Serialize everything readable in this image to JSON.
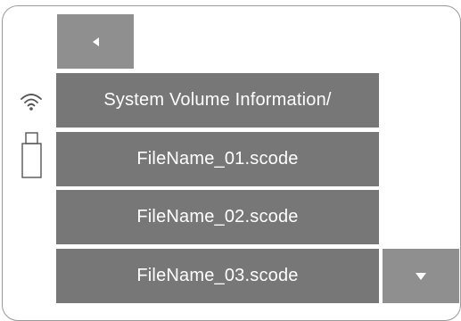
{
  "nav": {
    "back_icon": "back-arrow-icon",
    "down_icon": "scroll-down-icon"
  },
  "status": {
    "wifi_icon": "wifi-icon",
    "storage_icon": "usb-drive-icon"
  },
  "file_list": {
    "items": [
      {
        "label": "System Volume Information/"
      },
      {
        "label": "FileName_01.scode"
      },
      {
        "label": "FileName_02.scode"
      },
      {
        "label": "FileName_03.scode"
      }
    ]
  },
  "colors": {
    "button": "#777777",
    "nav_button": "#8f8f8f",
    "text": "#ffffff",
    "frame": "#9a9a9a"
  }
}
